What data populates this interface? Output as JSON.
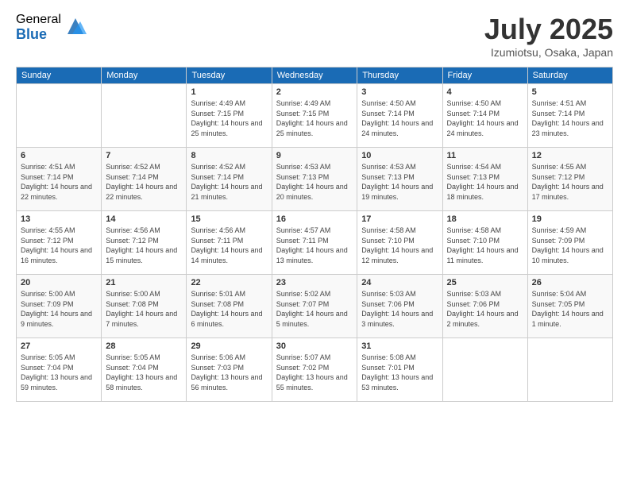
{
  "header": {
    "logo_general": "General",
    "logo_blue": "Blue",
    "month_title": "July 2025",
    "location": "Izumiotsu, Osaka, Japan"
  },
  "days_of_week": [
    "Sunday",
    "Monday",
    "Tuesday",
    "Wednesday",
    "Thursday",
    "Friday",
    "Saturday"
  ],
  "weeks": [
    [
      {
        "day": "",
        "detail": ""
      },
      {
        "day": "",
        "detail": ""
      },
      {
        "day": "1",
        "detail": "Sunrise: 4:49 AM\nSunset: 7:15 PM\nDaylight: 14 hours\nand 25 minutes."
      },
      {
        "day": "2",
        "detail": "Sunrise: 4:49 AM\nSunset: 7:15 PM\nDaylight: 14 hours\nand 25 minutes."
      },
      {
        "day": "3",
        "detail": "Sunrise: 4:50 AM\nSunset: 7:14 PM\nDaylight: 14 hours\nand 24 minutes."
      },
      {
        "day": "4",
        "detail": "Sunrise: 4:50 AM\nSunset: 7:14 PM\nDaylight: 14 hours\nand 24 minutes."
      },
      {
        "day": "5",
        "detail": "Sunrise: 4:51 AM\nSunset: 7:14 PM\nDaylight: 14 hours\nand 23 minutes."
      }
    ],
    [
      {
        "day": "6",
        "detail": "Sunrise: 4:51 AM\nSunset: 7:14 PM\nDaylight: 14 hours\nand 22 minutes."
      },
      {
        "day": "7",
        "detail": "Sunrise: 4:52 AM\nSunset: 7:14 PM\nDaylight: 14 hours\nand 22 minutes."
      },
      {
        "day": "8",
        "detail": "Sunrise: 4:52 AM\nSunset: 7:14 PM\nDaylight: 14 hours\nand 21 minutes."
      },
      {
        "day": "9",
        "detail": "Sunrise: 4:53 AM\nSunset: 7:13 PM\nDaylight: 14 hours\nand 20 minutes."
      },
      {
        "day": "10",
        "detail": "Sunrise: 4:53 AM\nSunset: 7:13 PM\nDaylight: 14 hours\nand 19 minutes."
      },
      {
        "day": "11",
        "detail": "Sunrise: 4:54 AM\nSunset: 7:13 PM\nDaylight: 14 hours\nand 18 minutes."
      },
      {
        "day": "12",
        "detail": "Sunrise: 4:55 AM\nSunset: 7:12 PM\nDaylight: 14 hours\nand 17 minutes."
      }
    ],
    [
      {
        "day": "13",
        "detail": "Sunrise: 4:55 AM\nSunset: 7:12 PM\nDaylight: 14 hours\nand 16 minutes."
      },
      {
        "day": "14",
        "detail": "Sunrise: 4:56 AM\nSunset: 7:12 PM\nDaylight: 14 hours\nand 15 minutes."
      },
      {
        "day": "15",
        "detail": "Sunrise: 4:56 AM\nSunset: 7:11 PM\nDaylight: 14 hours\nand 14 minutes."
      },
      {
        "day": "16",
        "detail": "Sunrise: 4:57 AM\nSunset: 7:11 PM\nDaylight: 14 hours\nand 13 minutes."
      },
      {
        "day": "17",
        "detail": "Sunrise: 4:58 AM\nSunset: 7:10 PM\nDaylight: 14 hours\nand 12 minutes."
      },
      {
        "day": "18",
        "detail": "Sunrise: 4:58 AM\nSunset: 7:10 PM\nDaylight: 14 hours\nand 11 minutes."
      },
      {
        "day": "19",
        "detail": "Sunrise: 4:59 AM\nSunset: 7:09 PM\nDaylight: 14 hours\nand 10 minutes."
      }
    ],
    [
      {
        "day": "20",
        "detail": "Sunrise: 5:00 AM\nSunset: 7:09 PM\nDaylight: 14 hours\nand 9 minutes."
      },
      {
        "day": "21",
        "detail": "Sunrise: 5:00 AM\nSunset: 7:08 PM\nDaylight: 14 hours\nand 7 minutes."
      },
      {
        "day": "22",
        "detail": "Sunrise: 5:01 AM\nSunset: 7:08 PM\nDaylight: 14 hours\nand 6 minutes."
      },
      {
        "day": "23",
        "detail": "Sunrise: 5:02 AM\nSunset: 7:07 PM\nDaylight: 14 hours\nand 5 minutes."
      },
      {
        "day": "24",
        "detail": "Sunrise: 5:03 AM\nSunset: 7:06 PM\nDaylight: 14 hours\nand 3 minutes."
      },
      {
        "day": "25",
        "detail": "Sunrise: 5:03 AM\nSunset: 7:06 PM\nDaylight: 14 hours\nand 2 minutes."
      },
      {
        "day": "26",
        "detail": "Sunrise: 5:04 AM\nSunset: 7:05 PM\nDaylight: 14 hours\nand 1 minute."
      }
    ],
    [
      {
        "day": "27",
        "detail": "Sunrise: 5:05 AM\nSunset: 7:04 PM\nDaylight: 13 hours\nand 59 minutes."
      },
      {
        "day": "28",
        "detail": "Sunrise: 5:05 AM\nSunset: 7:04 PM\nDaylight: 13 hours\nand 58 minutes."
      },
      {
        "day": "29",
        "detail": "Sunrise: 5:06 AM\nSunset: 7:03 PM\nDaylight: 13 hours\nand 56 minutes."
      },
      {
        "day": "30",
        "detail": "Sunrise: 5:07 AM\nSunset: 7:02 PM\nDaylight: 13 hours\nand 55 minutes."
      },
      {
        "day": "31",
        "detail": "Sunrise: 5:08 AM\nSunset: 7:01 PM\nDaylight: 13 hours\nand 53 minutes."
      },
      {
        "day": "",
        "detail": ""
      },
      {
        "day": "",
        "detail": ""
      }
    ]
  ]
}
